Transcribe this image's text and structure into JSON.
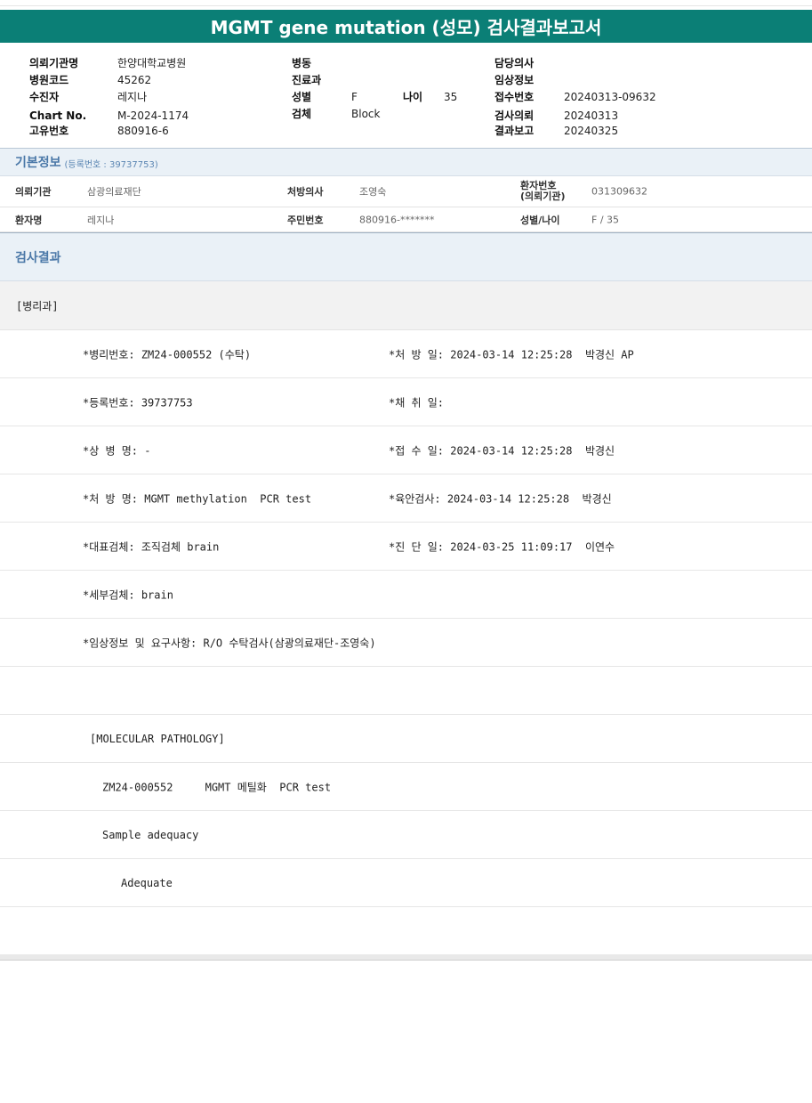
{
  "title": "MGMT gene mutation (성모) 검사결과보고서",
  "header": {
    "col1": [
      {
        "label": "의뢰기관명",
        "value": "한양대학교병원"
      },
      {
        "label": "병원코드",
        "value": "45262"
      },
      {
        "label": "수진자",
        "value": "레지나"
      },
      {
        "label": "Chart No.",
        "value": "M-2024-1174"
      },
      {
        "label": "고유번호",
        "value": "880916-6"
      }
    ],
    "col2": [
      {
        "label": "병동",
        "value": ""
      },
      {
        "label": "진료과",
        "value": ""
      },
      {
        "label": "성별",
        "value": "F"
      },
      {
        "label": "검체",
        "value": "Block"
      }
    ],
    "age": {
      "label": "나이",
      "value": "35"
    },
    "col3": [
      {
        "label": "담당의사",
        "value": ""
      },
      {
        "label": "임상정보",
        "value": ""
      },
      {
        "label": "접수번호",
        "value": "20240313-09632"
      },
      {
        "label": "검사의뢰",
        "value": "20240313"
      },
      {
        "label": "결과보고",
        "value": "20240325"
      }
    ]
  },
  "basic": {
    "title": "기본정보",
    "subtitle": "(등록번호 : 39737753)",
    "row1": {
      "inst_label": "의뢰기관",
      "inst_value": "삼광의료재단",
      "doctor_label": "처방의사",
      "doctor_value": "조영숙",
      "patno_label_1": "환자번호",
      "patno_label_2": "(의뢰기관)",
      "patno_value": "031309632"
    },
    "row2": {
      "name_label": "환자명",
      "name_value": "레지나",
      "rrn_label": "주민번호",
      "rrn_value": "880916-*******",
      "sexage_label": "성별/나이",
      "sexage_value": "F / 35"
    }
  },
  "results": {
    "title": "검사결과",
    "dept": "[병리과]",
    "lines": [
      {
        "left": "*병리번호: ZM24-000552 (수탁)",
        "right": "*처 방 일: 2024-03-14 12:25:28  박경신 AP"
      },
      {
        "left": "*등록번호: 39737753",
        "right": "*채 취 일:"
      },
      {
        "left": "*상 병 명: -",
        "right": "*접 수 일: 2024-03-14 12:25:28  박경신"
      },
      {
        "left": "*처 방 명: MGMT methylation  PCR test",
        "right": "*육안검사: 2024-03-14 12:25:28  박경신"
      },
      {
        "left": "*대표검체: 조직검체 brain",
        "right": "*진 단 일: 2024-03-25 11:09:17  이연수"
      },
      {
        "left": "*세부검체: brain",
        "right": ""
      },
      {
        "left": "*임상정보 및 요구사항: R/O 수탁검사(삼광의료재단-조영숙)",
        "right": ""
      }
    ],
    "molecular": {
      "heading": "[MOLECULAR PATHOLOGY]",
      "test_line": "ZM24-000552     MGMT 메틸화  PCR test",
      "adequacy_label": "Sample adequacy",
      "adequacy_value": "Adequate"
    }
  }
}
